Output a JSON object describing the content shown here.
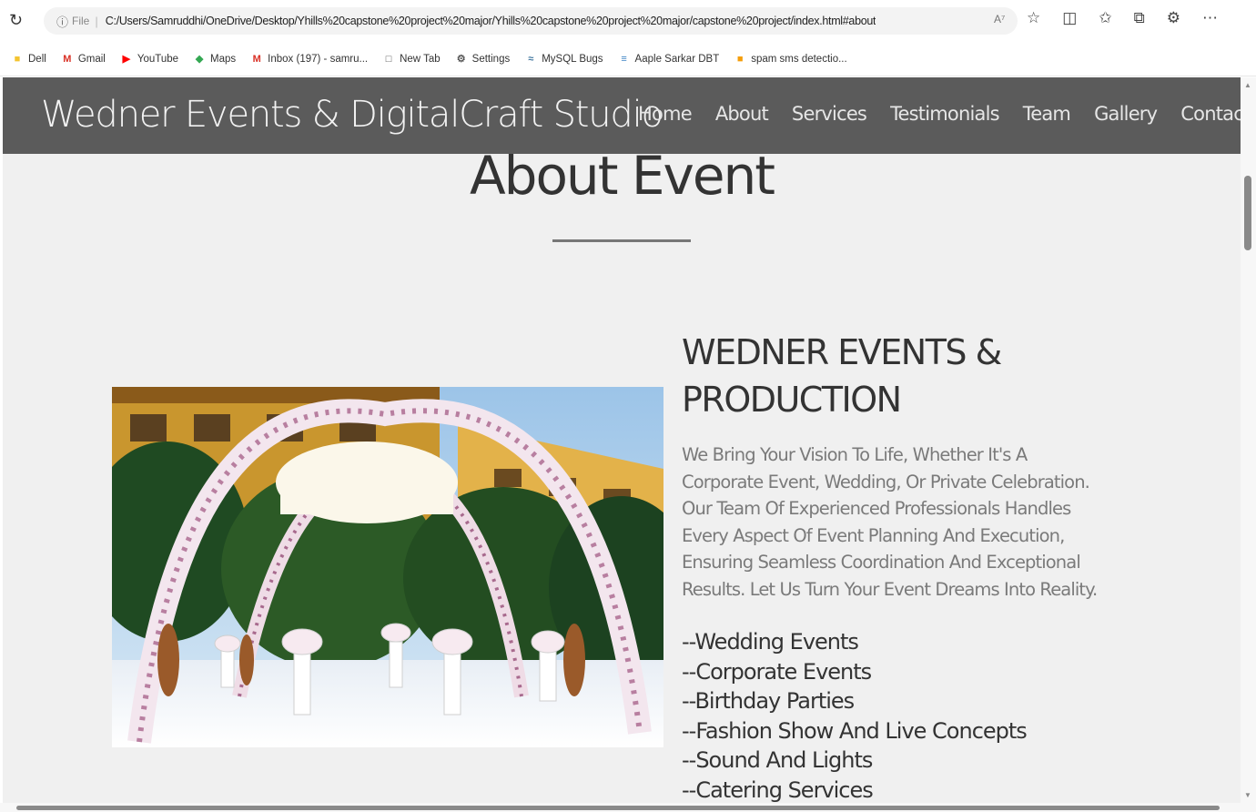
{
  "browser": {
    "file_label": "File",
    "url": "C:/Users/Samruddhi/OneDrive/Desktop/Yhills%20capstone%20project%20major/Yhills%20capstone%20project%20major/capstone%20project/index.html#about",
    "read_aloud": "A⁷"
  },
  "bookmarks": [
    {
      "label": "Dell",
      "icon": "folder-icon",
      "color": "#f4c430"
    },
    {
      "label": "Gmail",
      "icon": "gmail-icon",
      "color": "#d93025"
    },
    {
      "label": "YouTube",
      "icon": "youtube-icon",
      "color": "#ff0000"
    },
    {
      "label": "Maps",
      "icon": "maps-icon",
      "color": "#34a853"
    },
    {
      "label": "Inbox (197) - samru...",
      "icon": "gmail-icon",
      "color": "#d93025"
    },
    {
      "label": "New Tab",
      "icon": "page-icon",
      "color": "#555555"
    },
    {
      "label": "Settings",
      "icon": "gear-icon",
      "color": "#555555"
    },
    {
      "label": "MySQL Bugs",
      "icon": "mysql-icon",
      "color": "#4479a1"
    },
    {
      "label": "Aaple Sarkar DBT",
      "icon": "document-icon",
      "color": "#3b82c4"
    },
    {
      "label": "spam sms detectio...",
      "icon": "app-icon",
      "color": "#f59e0b"
    }
  ],
  "navbar": {
    "brand": "Wedner Events & DigitalCraft Studio",
    "links": [
      "Home",
      "About",
      "Services",
      "Testimonials",
      "Team",
      "Gallery",
      "Contact"
    ]
  },
  "about": {
    "title": "About Event",
    "heading": "WEDNER EVENTS & PRODUCTION",
    "description": "We Bring Your Vision To Life, Whether It's A Corporate Event, Wedding, Or Private Celebration. Our Team Of Experienced Professionals Handles Every Aspect Of Event Planning And Execution, Ensuring Seamless Coordination And Exceptional Results. Let Us Turn Your Event Dreams Into Reality.",
    "services": [
      "--Wedding Events",
      "--Corporate Events",
      "--Birthday Parties",
      "--Fashion Show And Live Concepts",
      "--Sound And Lights",
      "--Catering Services"
    ]
  },
  "colors": {
    "navbar_bg": "#5b5b5b",
    "page_bg": "#f0f0f0",
    "heading_text": "#333333",
    "description_text": "#7a7a7a"
  }
}
